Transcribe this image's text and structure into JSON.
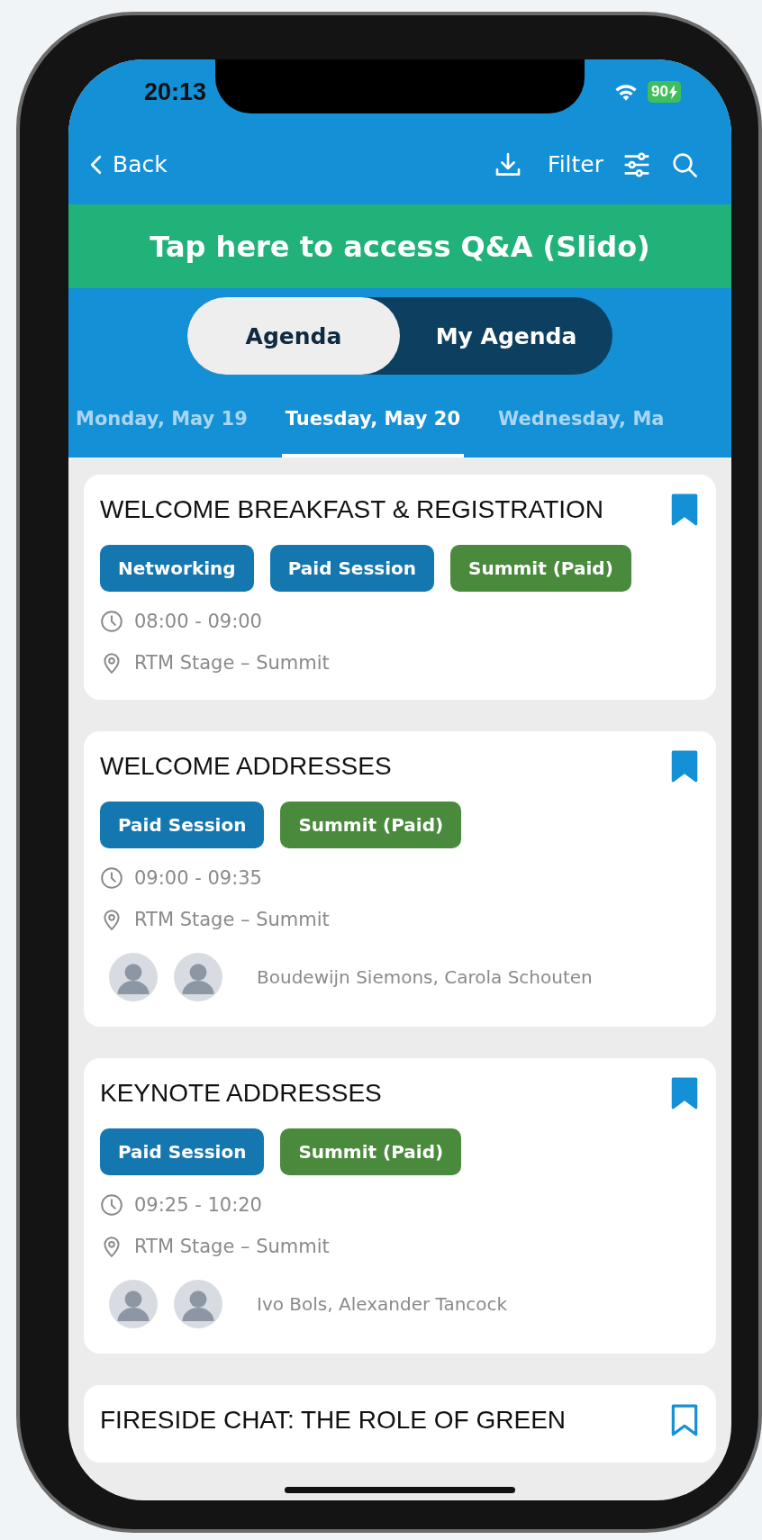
{
  "status_bar": {
    "time": "20:13",
    "battery": "90"
  },
  "nav": {
    "back": "Back",
    "filter": "Filter"
  },
  "banner": {
    "text": "Tap here to access Q&A (Slido)"
  },
  "segments": [
    {
      "label": "Agenda",
      "selected": true
    },
    {
      "label": "My Agenda",
      "selected": false
    }
  ],
  "day_tabs": [
    {
      "label": "Monday, May 19",
      "selected": false
    },
    {
      "label": "Tuesday, May 20",
      "selected": true
    },
    {
      "label": "Wednesday, Ma",
      "selected": false
    }
  ],
  "sessions": [
    {
      "title": "WELCOME BREAKFAST & REGISTRATION",
      "bookmarked": true,
      "tags": [
        {
          "label": "Networking",
          "color": "#1577b0"
        },
        {
          "label": "Paid Session",
          "color": "#1577b0"
        },
        {
          "label": "Summit (Paid)",
          "color": "#4a8a3c"
        }
      ],
      "time": "08:00 - 09:00",
      "location": "RTM Stage – Summit"
    },
    {
      "title": "WELCOME ADDRESSES",
      "bookmarked": true,
      "tags": [
        {
          "label": "Paid Session",
          "color": "#1577b0"
        },
        {
          "label": "Summit (Paid)",
          "color": "#4a8a3c"
        }
      ],
      "time": "09:00 - 09:35",
      "location": "RTM Stage – Summit",
      "speakers": "Boudewijn Siemons, Carola Schouten"
    },
    {
      "title": "KEYNOTE ADDRESSES",
      "bookmarked": true,
      "tags": [
        {
          "label": "Paid Session",
          "color": "#1577b0"
        },
        {
          "label": "Summit (Paid)",
          "color": "#4a8a3c"
        }
      ],
      "time": "09:25 - 10:20",
      "location": "RTM Stage – Summit",
      "speakers": "Ivo Bols, Alexander Tancock"
    },
    {
      "title": "FIRESIDE CHAT: THE ROLE OF GREEN",
      "bookmarked": false
    }
  ]
}
